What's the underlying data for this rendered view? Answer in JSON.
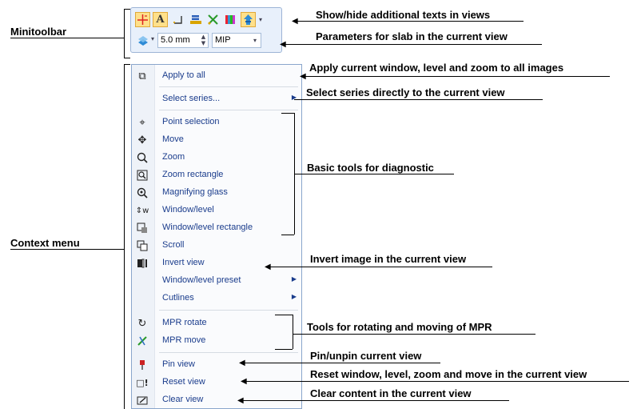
{
  "labels": {
    "minitoolbar": "Minitoolbar",
    "context_menu": "Context menu"
  },
  "minitoolbar": {
    "row1_icons": [
      "crosshair-icon",
      "text-a-icon",
      "corner-icon",
      "ruler-icon",
      "cross-icon",
      "color-bars-icon",
      "dicom-icon"
    ],
    "slab_thickness": "5.0 mm",
    "slab_mode": "MIP"
  },
  "menu": {
    "items": [
      {
        "label": "Apply to all",
        "icon": "apply-all-icon"
      },
      {
        "label": "Select series...",
        "icon": "",
        "submenu": true
      },
      {
        "label": "Point selection",
        "icon": "point-selection-icon"
      },
      {
        "label": "Move",
        "icon": "move-icon"
      },
      {
        "label": "Zoom",
        "icon": "zoom-icon"
      },
      {
        "label": "Zoom rectangle",
        "icon": "zoom-rectangle-icon"
      },
      {
        "label": "Magnifying glass",
        "icon": "magnifying-glass-icon"
      },
      {
        "label": "Window/level",
        "icon": "window-level-icon"
      },
      {
        "label": "Window/level rectangle",
        "icon": "window-level-rectangle-icon"
      },
      {
        "label": "Scroll",
        "icon": "scroll-icon"
      },
      {
        "label": "Invert view",
        "icon": "invert-view-icon"
      },
      {
        "label": "Window/level preset",
        "icon": "",
        "submenu": true
      },
      {
        "label": "Cutlines",
        "icon": "",
        "submenu": true
      },
      {
        "label": "MPR rotate",
        "icon": "mpr-rotate-icon"
      },
      {
        "label": "MPR move",
        "icon": "mpr-move-icon"
      },
      {
        "label": "Pin view",
        "icon": "pin-icon"
      },
      {
        "label": "Reset view",
        "icon": "reset-view-icon"
      },
      {
        "label": "Clear view",
        "icon": "clear-view-icon"
      }
    ]
  },
  "callouts": {
    "show_hide_texts": "Show/hide additional texts in views",
    "slab_params": "Parameters for slab in the current view",
    "apply_all": "Apply current window, level and zoom to all images",
    "select_series": "Select series directly to the current view",
    "basic_tools": "Basic tools for diagnostic",
    "invert": "Invert image in the current view",
    "mpr_tools": "Tools for rotating and moving of MPR",
    "pin": "Pin/unpin current view",
    "reset": "Reset window, level, zoom and move in the current view",
    "clear": "Clear content in the current view"
  }
}
